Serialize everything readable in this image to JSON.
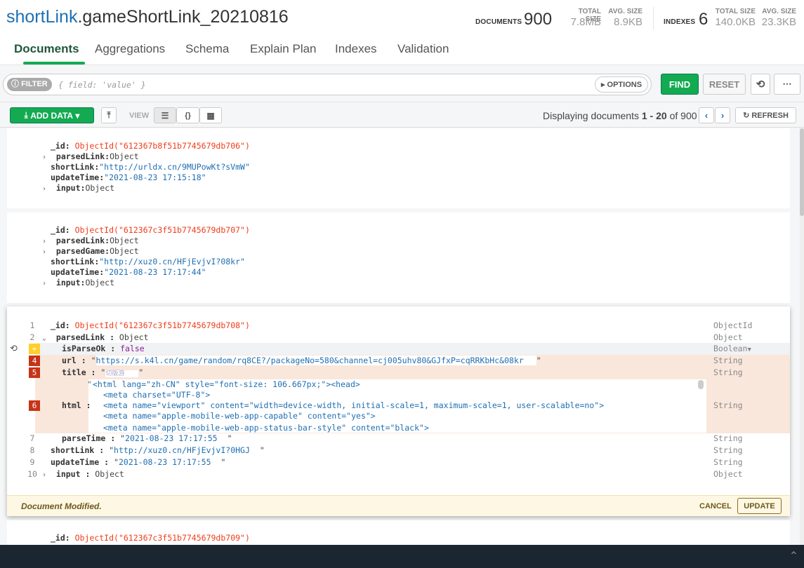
{
  "header": {
    "db": "shortLink",
    "collection": ".gameShortLink_20210816",
    "documents_label": "DOCUMENTS",
    "documents_count": "900",
    "total_size_label": "TOTAL SIZE",
    "total_size": "7.8MB",
    "avg_size_label": "AVG. SIZE",
    "avg_size": "8.9KB",
    "indexes_label": "INDEXES",
    "indexes_count": "6",
    "idx_total_size": "140.0KB",
    "idx_avg_size": "23.3KB"
  },
  "tabs": [
    "Documents",
    "Aggregations",
    "Schema",
    "Explain Plan",
    "Indexes",
    "Validation"
  ],
  "filter": {
    "badge": "FILTER",
    "placeholder": "{ field: 'value' }",
    "options": "OPTIONS",
    "find": "FIND",
    "reset": "RESET"
  },
  "toolbar": {
    "add_data": "ADD DATA",
    "view_label": "VIEW",
    "displaying": "Displaying documents",
    "range_start": "1",
    "range_sep": "-",
    "range_end": "20",
    "of": "of",
    "total": "900",
    "refresh": "REFRESH"
  },
  "accent": "#13aa52",
  "docs": [
    {
      "id": "ObjectId(\"612367b8f51b7745679db706\")",
      "fields": [
        [
          "parsedLink",
          "Object"
        ],
        [
          "shortLink",
          "\"http://urldx.cn/9MUPowKt?sVmW\""
        ],
        [
          "updateTime",
          "\"2021-08-23 17:15:18\""
        ],
        [
          "input",
          "Object"
        ]
      ]
    },
    {
      "id": "ObjectId(\"612367c3f51b7745679db707\")",
      "fields": [
        [
          "parsedLink",
          "Object"
        ],
        [
          "parsedGame",
          "Object"
        ],
        [
          "shortLink",
          "\"http://xuz0.cn/HFjEvjvI?08kr\""
        ],
        [
          "updateTime",
          "\"2021-08-23 17:17:44\""
        ],
        [
          "input",
          "Object"
        ]
      ]
    }
  ],
  "editor": {
    "id_key": "_id",
    "id_val": "ObjectId(\"612367c3f51b7745679db708\")",
    "parsedLink_key": "parsedLink",
    "parsedLink_val": "Object",
    "isParseOk_key": "isParseOk",
    "isParseOk_val": "false",
    "url_key": "url",
    "url_val": "https://s.k4l.cn/game/random/rq8CE?/packageNo=580&channel=cj005uhv80&GJfxP=cqRRKbHc&08kr",
    "title_key": "title",
    "title_val": "切版游",
    "html_key": "html",
    "html_lines": [
      "<html lang=\"zh-CN\" style=\"font-size: 106.667px;\"><head>",
      "<meta charset=\"UTF-8\">",
      "<meta name=\"viewport\" content=\"width=device-width, initial-scale=1, maximum-scale=1, user-scalable=no\">",
      "<meta name=\"apple-mobile-web-app-capable\" content=\"yes\">",
      "<meta name=\"apple-mobile-web-app-status-bar-style\" content=\"black\">"
    ],
    "parseTime_key": "parseTime",
    "parseTime_val": "2021-08-23 17:17:55",
    "shortLink_key": "shortLink",
    "shortLink_val": "http://xuz0.cn/HFjEvjvI?0HGJ",
    "updateTime_key": "updateTime",
    "updateTime_val": "2021-08-23 17:17:55",
    "input_key": "input",
    "input_val": "Object",
    "line_numbers": [
      "1",
      "2",
      "4",
      "5",
      "6",
      "7",
      "8",
      "9",
      "10"
    ],
    "added_marker": "+",
    "types": [
      "ObjectId",
      "Object",
      "Boolean",
      "String",
      "String",
      "String",
      "String",
      "String",
      "String",
      "Object"
    ],
    "footer_msg": "Document Modified.",
    "cancel": "CANCEL",
    "update": "UPDATE"
  },
  "next_doc": {
    "id": "ObjectId(\"612367c3f51b7745679db709\")"
  }
}
